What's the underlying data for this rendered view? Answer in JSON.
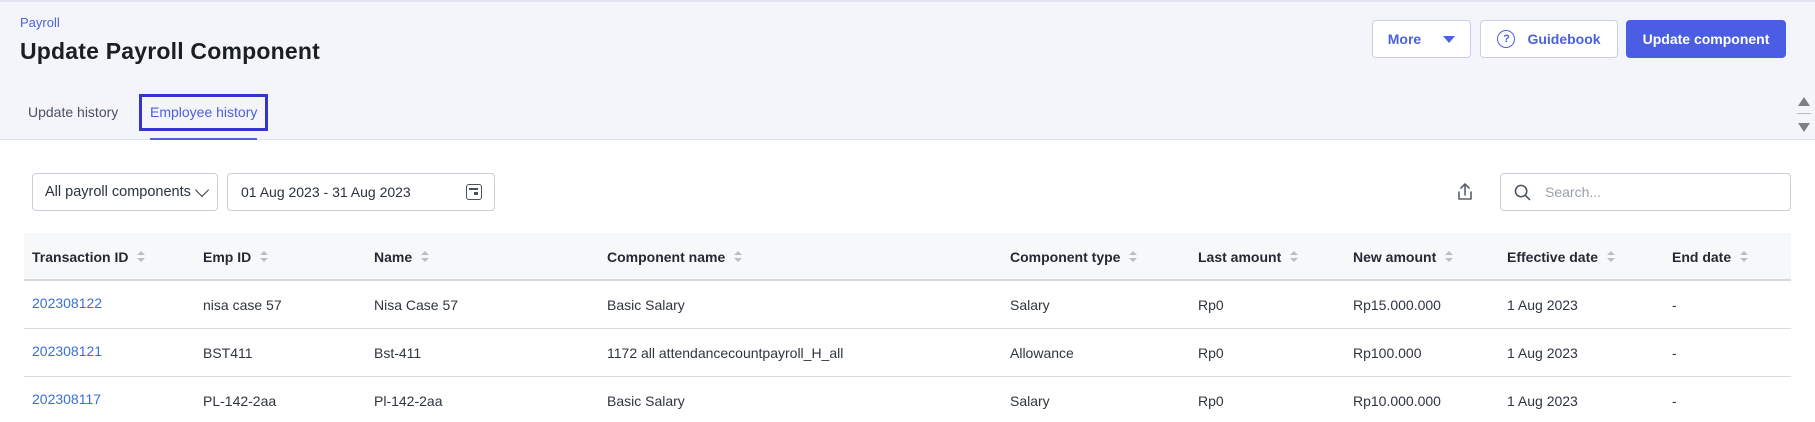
{
  "header": {
    "breadcrumb": "Payroll",
    "title": "Update Payroll Component",
    "more_label": "More",
    "guidebook_label": "Guidebook",
    "update_label": "Update component"
  },
  "tabs": [
    {
      "label": "Update history",
      "active": false
    },
    {
      "label": "Employee history",
      "active": true
    }
  ],
  "filters": {
    "component_select": "All payroll components",
    "date_range": "01 Aug 2023 - 31 Aug 2023",
    "search_placeholder": "Search..."
  },
  "table": {
    "columns": [
      "Transaction ID",
      "Emp ID",
      "Name",
      "Component name",
      "Component type",
      "Last amount",
      "New amount",
      "Effective date",
      "End date"
    ],
    "rows": [
      [
        "202308122",
        "nisa case 57",
        "Nisa Case 57",
        "Basic Salary",
        "Salary",
        "Rp0",
        "Rp15.000.000",
        "1 Aug 2023",
        "-"
      ],
      [
        "202308121",
        "BST411",
        "Bst-411",
        "1172 all attendancecountpayroll_H_all",
        "Allowance",
        "Rp0",
        "Rp100.000",
        "1 Aug 2023",
        "-"
      ],
      [
        "202308117",
        "PL-142-2aa",
        "Pl-142-2aa",
        "Basic Salary",
        "Salary",
        "Rp0",
        "Rp10.000.000",
        "1 Aug 2023",
        "-"
      ]
    ]
  },
  "icons": {
    "more": "caret-down-icon",
    "guidebook": "question-circle-icon",
    "date": "calendar-icon",
    "export": "export-icon",
    "search": "search-icon",
    "sort": "sort-icon"
  },
  "colors": {
    "accent": "#4b61dd",
    "primary_button": "#4b5ee3",
    "link": "#3a6fd8",
    "header_bg": "#f3f5fa",
    "tab_highlight": "#3535c8"
  }
}
